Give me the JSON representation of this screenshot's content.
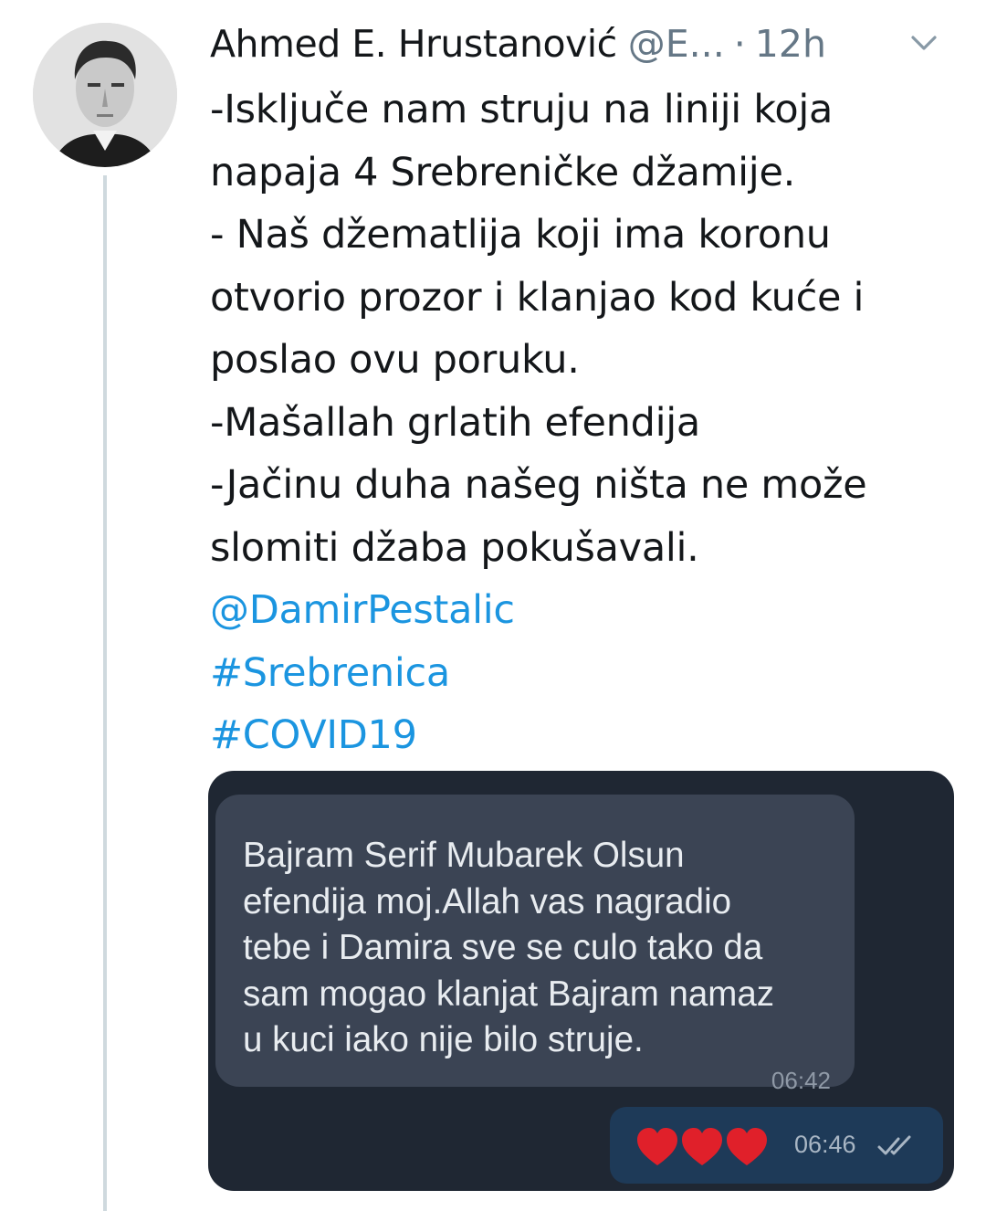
{
  "tweet": {
    "author_name": "Ahmed E. Hrustanović",
    "handle": "@E...",
    "separator": "·",
    "time": "12h",
    "body_lines": [
      "-Isključe nam struju na liniji koja",
      "napaja 4 Srebreničke džamije.",
      "- Naš džematlija koji ima koronu",
      "otvorio prozor i klanjao kod kuće i",
      "poslao ovu poruku.",
      "-Mašallah grlatih efendija",
      "-Jačinu duha našeg ništa ne može",
      "slomiti džaba pokušavali."
    ],
    "mention": "@DamirPestalic",
    "hashtags": [
      "#Srebrenica",
      "#COVID19"
    ],
    "icons": {
      "more": "chevron-down-icon",
      "avatar": "avatar"
    }
  },
  "chat_screenshot": {
    "incoming_message_lines": [
      "Bajram Serif Mubarek Olsun",
      "efendija moj.Allah vas nagradio",
      "tebe i Damira sve se culo tako da",
      "sam mogao klanjat Bajram namaz",
      "u kuci iako nije bilo struje."
    ],
    "incoming_time": "06:42",
    "outgoing_time": "06:46",
    "outgoing_content": "heart-emoji x3",
    "read_status": "double-check-icon"
  },
  "colors": {
    "link": "#1b95e0",
    "text": "#14171a",
    "muted": "#657786",
    "thread_line": "#cfd9de",
    "chat_bg": "#1f2733",
    "incoming_bubble": "#3b4454",
    "outgoing_bubble": "#1e3a58",
    "heart": "#e0202a"
  }
}
